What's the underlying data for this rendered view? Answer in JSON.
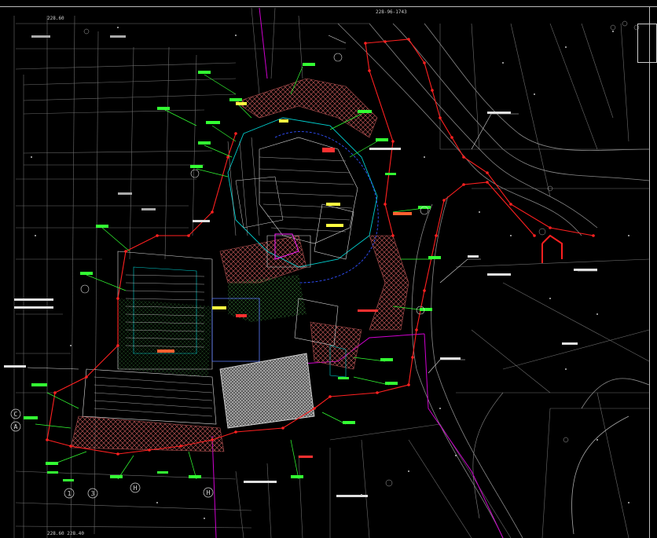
{
  "drawing": {
    "type": "CAD site plan (dark model space)",
    "background": "#000000",
    "colors": {
      "background_lines": "#8a8a8a",
      "boundary": "#ff2020",
      "callouts": "#33ff33",
      "building_outline": "#00cfcf",
      "paving_hatch": "#b05050",
      "plaza_hatch": "#bdbdbd",
      "magenta_line": "#d000d0",
      "yellow_text": "#ffff40",
      "blue_curve": "#3050ff"
    }
  },
  "coordinates": {
    "top_center": "228-96-1743",
    "top_left": "228.60",
    "bottom_left": "228.60 228.40"
  },
  "axis_markers": [
    "C",
    "A",
    "1",
    "3",
    "H",
    "H"
  ]
}
